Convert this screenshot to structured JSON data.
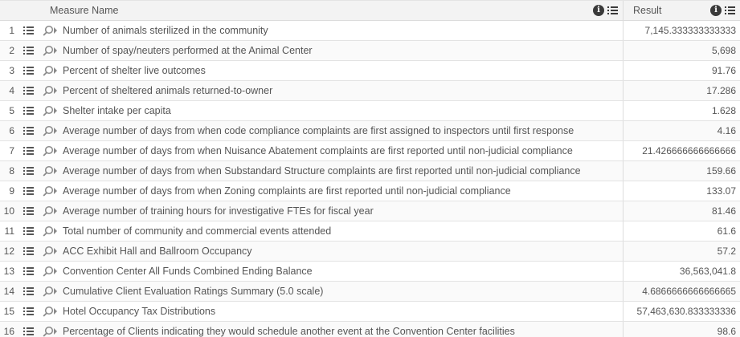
{
  "header": {
    "measure_name_label": "Measure Name",
    "result_label": "Result",
    "info_icon": "info-icon",
    "menu_icon": "list-menu-icon"
  },
  "rows": [
    {
      "num": "1",
      "measure": "Number of animals sterilized in the community",
      "result": "7,145.333333333333"
    },
    {
      "num": "2",
      "measure": "Number of spay/neuters performed at the Animal Center",
      "result": "5,698"
    },
    {
      "num": "3",
      "measure": "Percent of shelter live outcomes",
      "result": "91.76"
    },
    {
      "num": "4",
      "measure": "Percent of sheltered animals returned-to-owner",
      "result": "17.286"
    },
    {
      "num": "5",
      "measure": "Shelter intake per capita",
      "result": "1.628"
    },
    {
      "num": "6",
      "measure": "Average number of days from when code compliance complaints are first assigned to inspectors until first response",
      "result": "4.16"
    },
    {
      "num": "7",
      "measure": "Average number of days from when Nuisance Abatement complaints are first reported until non-judicial compliance",
      "result": "21.426666666666666"
    },
    {
      "num": "8",
      "measure": "Average number of days from when Substandard Structure complaints are first reported until non-judicial compliance",
      "result": "159.66"
    },
    {
      "num": "9",
      "measure": "Average number of days from when Zoning complaints are first reported until non-judicial compliance",
      "result": "133.07"
    },
    {
      "num": "10",
      "measure": "Average number of training hours for investigative FTEs for fiscal year",
      "result": "81.46"
    },
    {
      "num": "11",
      "measure": "Total number of community and commercial events attended",
      "result": "61.6"
    },
    {
      "num": "12",
      "measure": "ACC Exhibit Hall and Ballroom Occupancy",
      "result": "57.2"
    },
    {
      "num": "13",
      "measure": "Convention Center All Funds Combined Ending Balance",
      "result": "36,563,041.8"
    },
    {
      "num": "14",
      "measure": "Cumulative Client Evaluation Ratings Summary (5.0 scale)",
      "result": "4.6866666666666665"
    },
    {
      "num": "15",
      "measure": "Hotel Occupancy Tax Distributions",
      "result": "57,463,630.833333336"
    },
    {
      "num": "16",
      "measure": "Percentage of Clients indicating they would schedule another event at the Convention Center facilities",
      "result": "98.6"
    }
  ]
}
